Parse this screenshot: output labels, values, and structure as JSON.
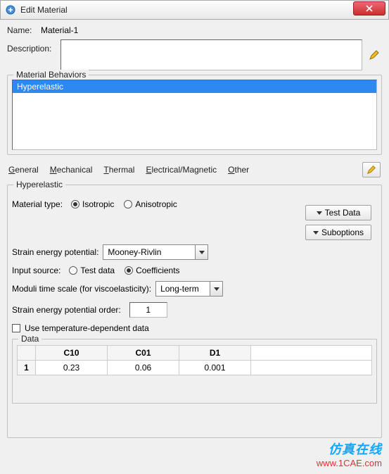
{
  "window": {
    "title": "Edit Material"
  },
  "name": {
    "label": "Name:",
    "value": "Material-1"
  },
  "description": {
    "label": "Description:",
    "value": ""
  },
  "behaviors": {
    "legend": "Material Behaviors",
    "items": [
      "Hyperelastic"
    ]
  },
  "tabs": {
    "general": "General",
    "mechanical": "Mechanical",
    "thermal": "Thermal",
    "electrical": "Electrical/Magnetic",
    "other": "Other"
  },
  "hyper": {
    "legend": "Hyperelastic",
    "materialTypeLabel": "Material type:",
    "isotropic": "Isotropic",
    "anisotropic": "Anisotropic",
    "testData": "Test Data",
    "suboptions": "Suboptions",
    "strainPotentialLabel": "Strain energy potential:",
    "strainPotentialValue": "Mooney-Rivlin",
    "inputSourceLabel": "Input source:",
    "testDataOpt": "Test data",
    "coefficients": "Coefficients",
    "moduliLabel": "Moduli time scale (for viscoelasticity):",
    "moduliValue": "Long-term",
    "orderLabel": "Strain energy potential order:",
    "orderValue": "1",
    "tempDep": "Use temperature-dependent data"
  },
  "dataTable": {
    "legend": "Data",
    "headers": {
      "rownum": "",
      "c10": "C10",
      "c01": "C01",
      "d1": "D1"
    },
    "rows": [
      {
        "num": "1",
        "c10": "0.23",
        "c01": "0.06",
        "d1": "0.001"
      }
    ]
  },
  "watermark": {
    "line1": "仿真在线",
    "line2": "www.1CAE.com"
  }
}
